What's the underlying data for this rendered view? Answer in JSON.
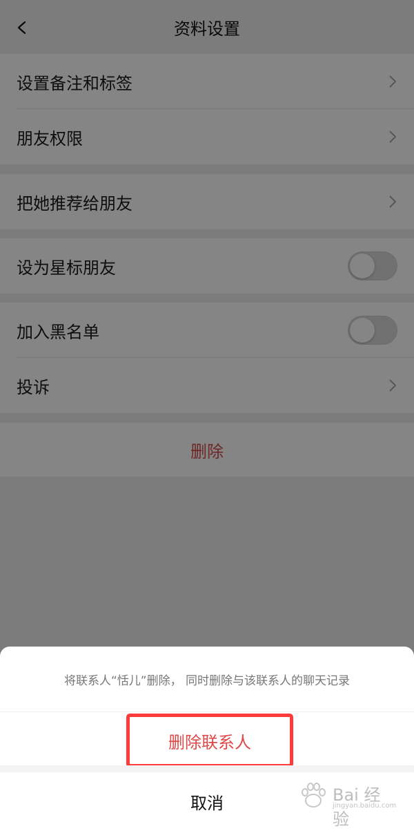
{
  "header": {
    "title": "资料设置",
    "back_icon": "chevron-left-icon"
  },
  "settings": {
    "group1": [
      {
        "label": "设置备注和标签",
        "control": "chevron"
      },
      {
        "label": "朋友权限",
        "control": "chevron"
      }
    ],
    "group2": [
      {
        "label": "把她推荐给朋友",
        "control": "chevron"
      }
    ],
    "group3": [
      {
        "label": "设为星标朋友",
        "control": "toggle",
        "on": false
      }
    ],
    "group4": [
      {
        "label": "加入黑名单",
        "control": "toggle",
        "on": false
      },
      {
        "label": "投诉",
        "control": "chevron"
      }
    ],
    "delete_label": "删除"
  },
  "action_sheet": {
    "message": "将联系人“恬儿”删除， 同时删除与该联系人的聊天记录",
    "confirm_label": "删除联系人",
    "cancel_label": "取消"
  },
  "watermark": {
    "text": "Bai 经验",
    "url": "jingyan.baidu.com"
  },
  "colors": {
    "danger": "#e04848",
    "highlight_box": "#ff3b3b",
    "background": "#ededed"
  }
}
